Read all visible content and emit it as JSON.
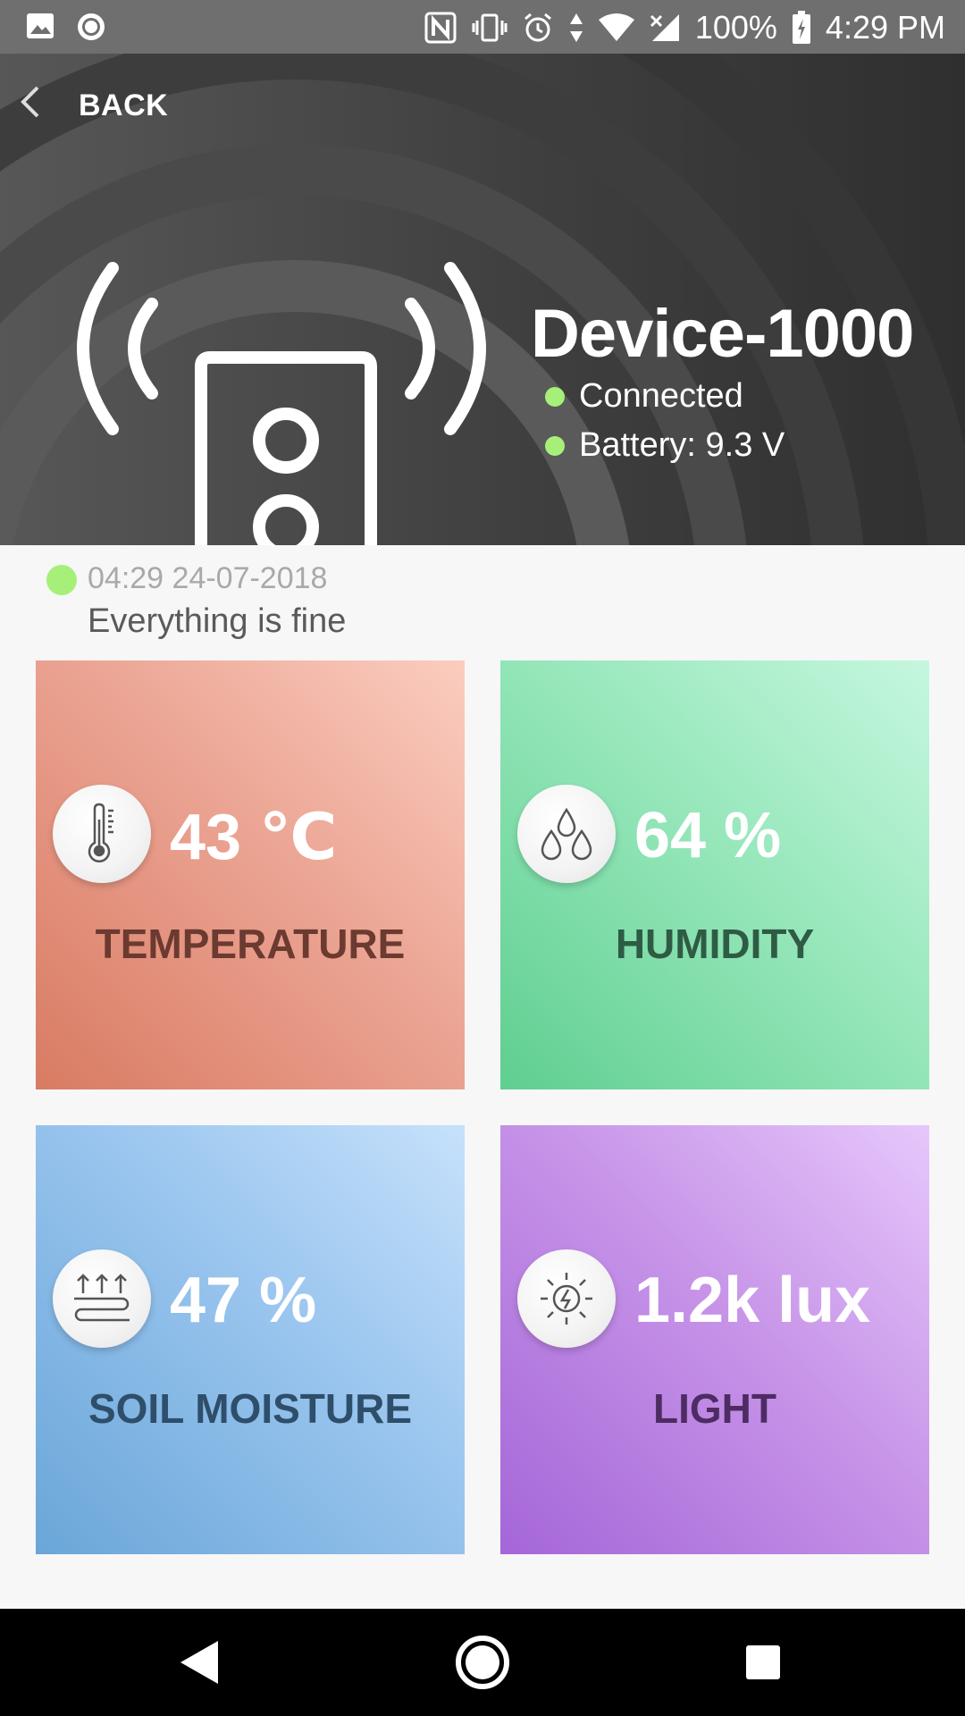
{
  "status_bar": {
    "battery": "100%",
    "time": "4:29 PM",
    "icons": [
      "image-icon",
      "record-icon",
      "nfc-icon",
      "vibrate-icon",
      "alarm-icon",
      "data-arrows-icon",
      "wifi-icon",
      "signal-icon",
      "battery-icon"
    ]
  },
  "header": {
    "back_label": "BACK",
    "device_name": "Device-1000",
    "connection_status": "Connected",
    "battery_status": "Battery: 9.3 V",
    "status_color": "#a6f07a"
  },
  "update": {
    "timestamp": "04:29  24-07-2018",
    "message": "Everything is fine"
  },
  "tiles": [
    {
      "value": "43 ℃",
      "label": "TEMPERATURE",
      "icon": "thermometer-icon"
    },
    {
      "value": "64 %",
      "label": "HUMIDITY",
      "icon": "water-drops-icon"
    },
    {
      "value": "47 %",
      "label": "SOIL MOISTURE",
      "icon": "soil-moisture-icon"
    },
    {
      "value": "1.2k lux",
      "label": "LIGHT",
      "icon": "sun-icon"
    }
  ],
  "nav": [
    "back-nav-icon",
    "home-nav-icon",
    "recents-nav-icon"
  ]
}
